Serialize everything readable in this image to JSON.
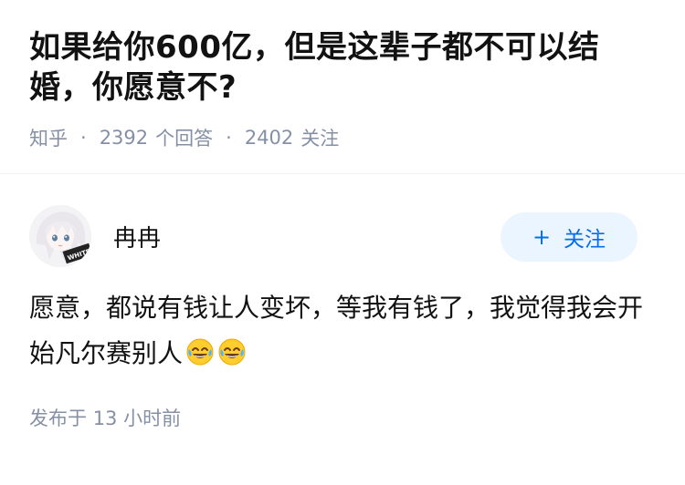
{
  "question": {
    "title": "如果给你600亿，但是这辈子都不可以结婚，你愿意不?",
    "source": "知乎",
    "separator": "·",
    "answers_count": "2392",
    "answers_label": "个回答",
    "followers_count": "2402",
    "followers_label": "关注"
  },
  "answer": {
    "author_name": "冉冉",
    "avatar_text": "WHITE",
    "follow_plus": "+",
    "follow_label": "关注",
    "content": "愿意，都说有钱让人变坏，等我有钱了，我觉得我会开始凡尔赛别人",
    "emojis": [
      "joy-emoji",
      "joy-emoji"
    ],
    "time_prefix": "发布于",
    "time_value": "13 小时前"
  }
}
